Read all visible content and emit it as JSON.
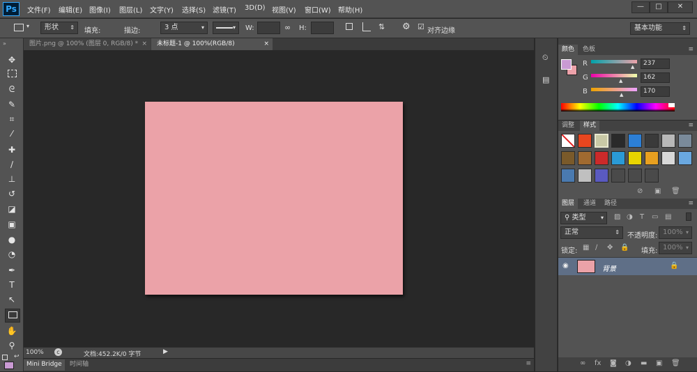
{
  "app": {
    "logo": "Ps"
  },
  "menu": [
    "文件(F)",
    "编辑(E)",
    "图像(I)",
    "图层(L)",
    "文字(Y)",
    "选择(S)",
    "滤镜(T)",
    "3D(D)",
    "视图(V)",
    "窗口(W)",
    "帮助(H)"
  ],
  "window_controls": {
    "minimize": "—",
    "restore": "□",
    "close": "✕"
  },
  "options_bar": {
    "mode": "形状",
    "fill_label": "填充:",
    "fill_color": "#c98fce",
    "stroke_label": "描边:",
    "stroke_width": "3 点",
    "w_label": "W:",
    "w_value": "",
    "h_label": "H:",
    "h_value": "",
    "align_edges_label": "对齐边缘",
    "align_edges_checked": true,
    "workspace": "基本功能"
  },
  "tabs": [
    {
      "label": "图片.png @ 100% (图层 0, RGB/8) *",
      "active": false
    },
    {
      "label": "未标题-1 @ 100%(RGB/8)",
      "active": true
    }
  ],
  "tools": [
    "move-tool",
    "marquee-tool",
    "lasso-tool",
    "quick-select-tool",
    "crop-tool",
    "eyedropper-tool",
    "healing-brush-tool",
    "brush-tool",
    "clone-stamp-tool",
    "history-brush-tool",
    "eraser-tool",
    "gradient-tool",
    "blur-tool",
    "dodge-tool",
    "pen-tool",
    "type-tool",
    "path-select-tool",
    "rectangle-tool",
    "hand-tool",
    "zoom-tool"
  ],
  "document": {
    "fill_color": "#eba2a8"
  },
  "status": {
    "zoom": "100%",
    "doc_info": "文档:452.2K/0 字节"
  },
  "bottom_tabs": [
    "Mini Bridge",
    "时间轴"
  ],
  "color_panel": {
    "tabs": [
      "颜色",
      "色板"
    ],
    "fg_color": "#c99ad3",
    "bg_color": "#eda2aa",
    "r_label": "R",
    "r_value": "237",
    "g_label": "G",
    "g_value": "162",
    "b_label": "B",
    "b_value": "170"
  },
  "styles_panel": {
    "tabs": [
      "调整",
      "样式"
    ],
    "swatch_colors": [
      "#ffffff",
      "#e8461f",
      "#c9c9a6",
      "#2a2a2a",
      "#2c7fd6",
      "#3a3a3a",
      "#b8b8b8",
      "#7a8a9a",
      "#7a5a2a",
      "#a06a30",
      "#cc2a2a",
      "#2a9ad6",
      "#e8d400",
      "#e8a020",
      "#d8d8d8",
      "#6aa8e0",
      "#4a7ab0",
      "#c0c0c0",
      "#5a5ac0",
      "#4a4a4a",
      "#4a4a4a",
      "#4a4a4a"
    ]
  },
  "layers_panel": {
    "tabs": [
      "图层",
      "通道",
      "路径"
    ],
    "filter_kind": "类型",
    "blend_mode": "正常",
    "opacity_label": "不透明度:",
    "opacity_value": "100%",
    "lock_label": "锁定:",
    "fill_label": "填充:",
    "fill_value": "100%",
    "layers": [
      {
        "name": "背景",
        "thumb_color": "#eba2a8",
        "visible": true,
        "locked": true
      }
    ]
  }
}
